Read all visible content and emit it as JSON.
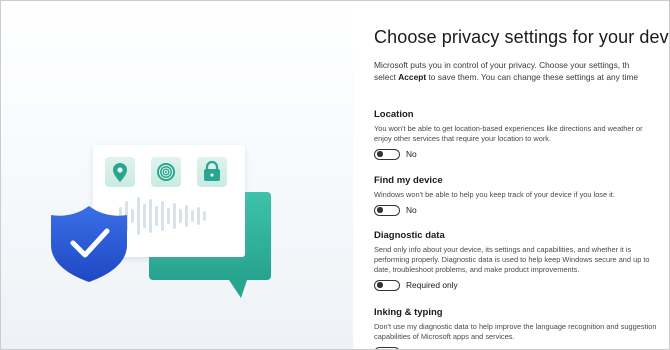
{
  "title": "Choose privacy settings for your device",
  "intro": {
    "line1": "Microsoft puts you in control of your privacy. Choose your settings, th",
    "line2_prefix": "select ",
    "line2_bold": "Accept",
    "line2_suffix": " to save them. You can change these settings at any time"
  },
  "settings": [
    {
      "title": "Location",
      "description": "You won't be able to get location-based experiences like directions and weather or enjoy other services that require your location to work.",
      "state": "No"
    },
    {
      "title": "Find my device",
      "description": "Windows won't be able to help you keep track of your device if you lose it.",
      "state": "No"
    },
    {
      "title": "Diagnostic data",
      "description": "Send only info about your device, its settings and capabilities, and whether it is performing properly. Diagnostic data is used to help keep Windows secure and up to date, troubleshoot problems, and make product improvements.",
      "state": "Required only"
    },
    {
      "title": "Inking & typing",
      "description": "Don't use my diagnostic data to help improve the language recognition and suggestion capabilities of Microsoft apps and services.",
      "state": ""
    }
  ],
  "illustration": {
    "icons": [
      "location-pin-icon",
      "fingerprint-icon",
      "lock-icon",
      "shield-check-icon"
    ],
    "colors": {
      "teal": "#35b9a4",
      "teal_light": "#55c7b4",
      "blue_shield": "#2f5fd9",
      "card": "#ffffff"
    }
  }
}
